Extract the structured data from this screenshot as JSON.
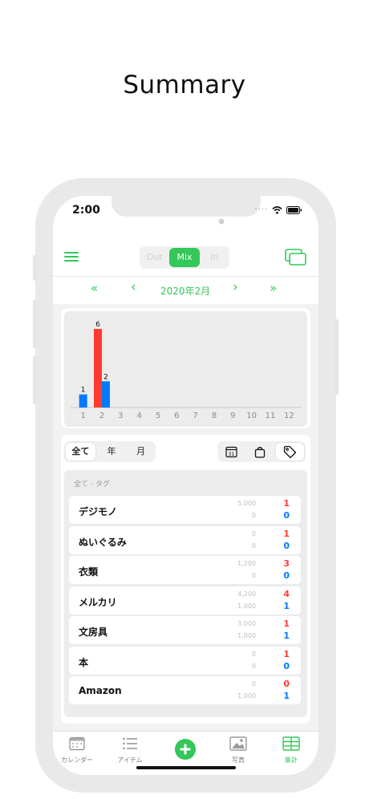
{
  "headline": "Summary",
  "status": {
    "time": "2:00"
  },
  "mode_segment": {
    "items": [
      "Out",
      "Mix",
      "In"
    ],
    "selected": "Mix"
  },
  "date_nav": {
    "prev_year": "«",
    "prev_month": "‹",
    "label": "2020年2月",
    "next_month": "›",
    "next_year": "»"
  },
  "chart_data": {
    "type": "bar",
    "categories": [
      "1",
      "2",
      "3",
      "4",
      "5",
      "6",
      "7",
      "8",
      "9",
      "10",
      "11",
      "12"
    ],
    "series": [
      {
        "name": "",
        "color": "#ff3b30",
        "values": [
          0,
          6,
          0,
          0,
          0,
          0,
          0,
          0,
          0,
          0,
          0,
          0
        ]
      },
      {
        "name": "",
        "color": "#007aff",
        "values": [
          1,
          2,
          0,
          0,
          0,
          0,
          0,
          0,
          0,
          0,
          0,
          0
        ]
      }
    ],
    "data_labels": [
      {
        "category": "1",
        "value": "1"
      },
      {
        "category": "2",
        "value": "6"
      },
      {
        "category": "2",
        "value": "2"
      }
    ],
    "ylim": [
      0,
      6
    ],
    "grid": false,
    "title": "",
    "xlabel": "",
    "ylabel": ""
  },
  "period_segment": {
    "items": [
      "全て",
      "年",
      "月"
    ],
    "selected": "全て"
  },
  "type_segment": {
    "icons": [
      "calendar-icon",
      "bag-icon",
      "tag-icon"
    ],
    "selected": "tag-icon",
    "calendar_text": "31"
  },
  "list": {
    "header": "全て - タグ",
    "rows": [
      {
        "name": "デジモノ",
        "out_amount": "5,000",
        "in_amount": "0",
        "out_count": "1",
        "in_count": "0"
      },
      {
        "name": "ぬいぐるみ",
        "out_amount": "0",
        "in_amount": "0",
        "out_count": "1",
        "in_count": "0"
      },
      {
        "name": "衣類",
        "out_amount": "1,200",
        "in_amount": "0",
        "out_count": "3",
        "in_count": "0"
      },
      {
        "name": "メルカリ",
        "out_amount": "4,200",
        "in_amount": "1,000",
        "out_count": "4",
        "in_count": "1"
      },
      {
        "name": "文房具",
        "out_amount": "3,000",
        "in_amount": "1,000",
        "out_count": "1",
        "in_count": "1"
      },
      {
        "name": "本",
        "out_amount": "0",
        "in_amount": "0",
        "out_count": "1",
        "in_count": "0"
      },
      {
        "name": "Amazon",
        "out_amount": "0",
        "in_amount": "1,000",
        "out_count": "0",
        "in_count": "1"
      }
    ]
  },
  "tabbar": {
    "items": [
      {
        "label": "カレンダー",
        "icon": "calendar-tab-icon"
      },
      {
        "label": "アイテム",
        "icon": "list-icon"
      },
      {
        "label": "",
        "icon": "add-icon"
      },
      {
        "label": "写真",
        "icon": "photo-icon"
      },
      {
        "label": "集計",
        "icon": "summary-table-icon"
      }
    ],
    "selected": "集計"
  },
  "colors": {
    "accent": "#34c759",
    "out": "#ff3b30",
    "in": "#007aff"
  }
}
